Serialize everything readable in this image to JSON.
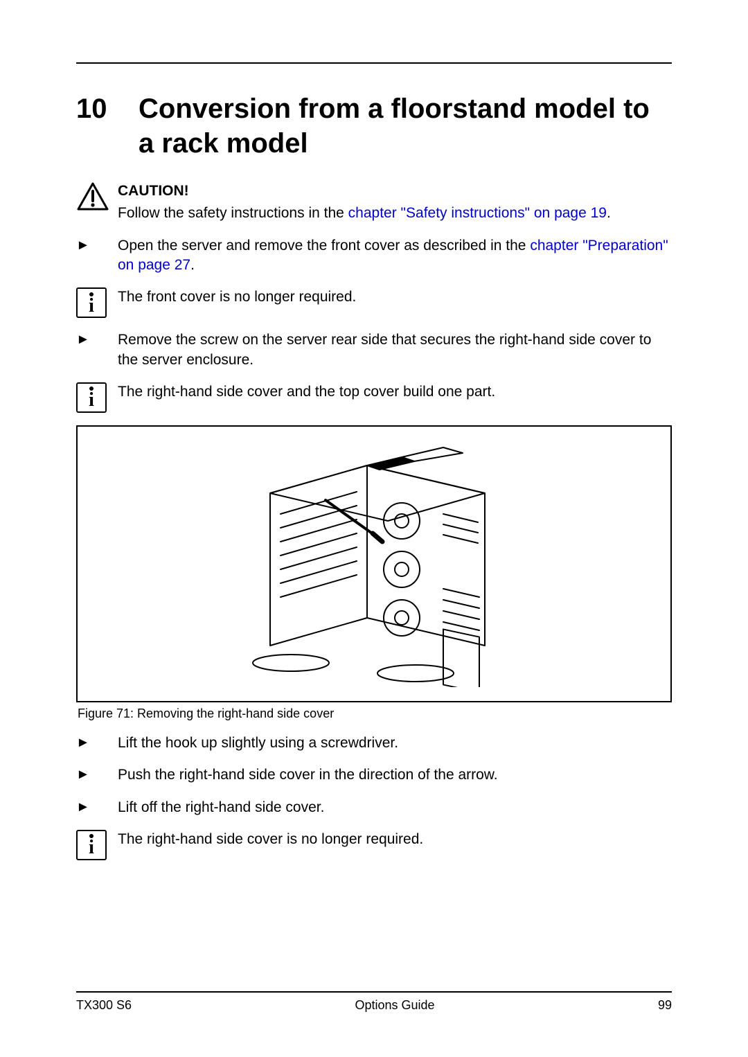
{
  "chapter": {
    "number": "10",
    "title": "Conversion from a floorstand model to a rack model"
  },
  "caution": {
    "label": "CAUTION!",
    "text_pre": "Follow the safety instructions in the ",
    "link": "chapter \"Safety instructions\" on page 19",
    "text_post": "."
  },
  "step1": {
    "text_pre": "Open the server and remove the front cover as described in the ",
    "link": "chapter \"Preparation\" on page 27",
    "text_post": "."
  },
  "info1": "The front cover is no longer required.",
  "step2": "Remove the screw on the server rear side that secures the right-hand side cover to the server enclosure.",
  "info2": "The right-hand side cover and the top cover build one part.",
  "figure": {
    "caption": "Figure 71: Removing the right-hand side cover"
  },
  "step3": "Lift the hook up slightly using a screwdriver.",
  "step4": "Push the right-hand side cover in the direction of the arrow.",
  "step5": "Lift off the right-hand side cover.",
  "info3": "The right-hand side cover is no longer required.",
  "footer": {
    "left": "TX300 S6",
    "center": "Options Guide",
    "right": "99"
  }
}
